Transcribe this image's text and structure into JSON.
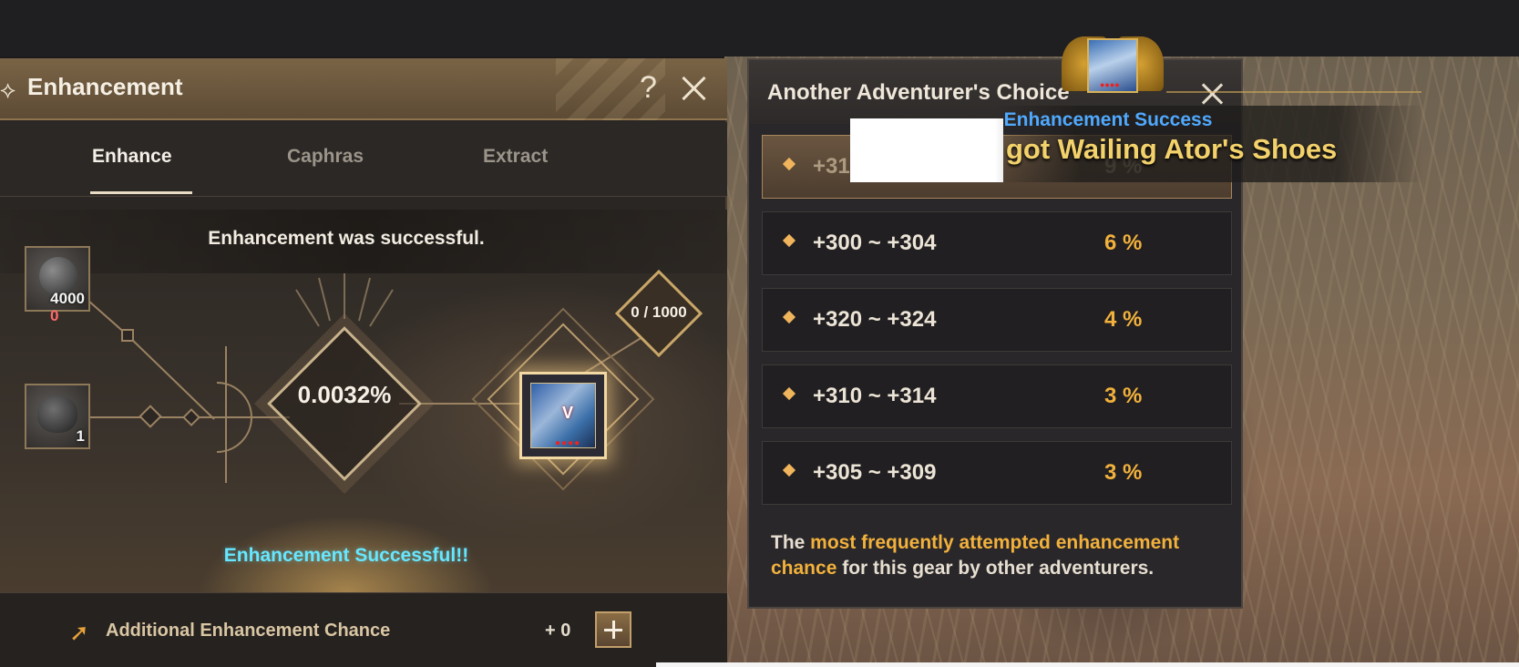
{
  "enhancement": {
    "title": "Enhancement",
    "help_label": "?",
    "tabs": [
      {
        "label": "Enhance",
        "active": true
      },
      {
        "label": "Caphras",
        "active": false
      },
      {
        "label": "Extract",
        "active": false
      }
    ],
    "status_message": "Enhancement was successful.",
    "material_slots": [
      {
        "icon": "black-stone-icon",
        "count": "4000",
        "owned": "0"
      },
      {
        "icon": "enhancement-material-icon",
        "count": "1"
      }
    ],
    "success_rate": "0.0032%",
    "failstack_counter": "0 / 1000",
    "item": {
      "icon": "wailing-ator-shoes-icon",
      "grade_badge": "V",
      "dots": "●●●●"
    },
    "result_message": "Enhancement Successful!!",
    "additional_chance_label": "Additional Enhancement Chance",
    "additional_chance_value": "+ 0"
  },
  "choice": {
    "title": "Another Adventurer's Choice",
    "rows": [
      {
        "range": "+31",
        "pct": "9 %"
      },
      {
        "range": "+300 ~ +304",
        "pct": "6 %"
      },
      {
        "range": "+320 ~ +324",
        "pct": "4 %"
      },
      {
        "range": "+310 ~ +314",
        "pct": "3 %"
      },
      {
        "range": "+305 ~ +309",
        "pct": "3 %"
      }
    ],
    "note_prefix": "The ",
    "note_highlight": "most frequently attempted enhancement chance",
    "note_suffix": " for this gear by other adventurers."
  },
  "notification": {
    "subtitle": "Enhancement Success",
    "message": "got Wailing Ator's Shoes",
    "item_dots": "●●●●"
  },
  "colors": {
    "accent_gold": "#f2b13c",
    "success_cyan": "#66e7ff",
    "notify_blue": "#4fa9ff",
    "warning_red": "#ff6b6b"
  }
}
